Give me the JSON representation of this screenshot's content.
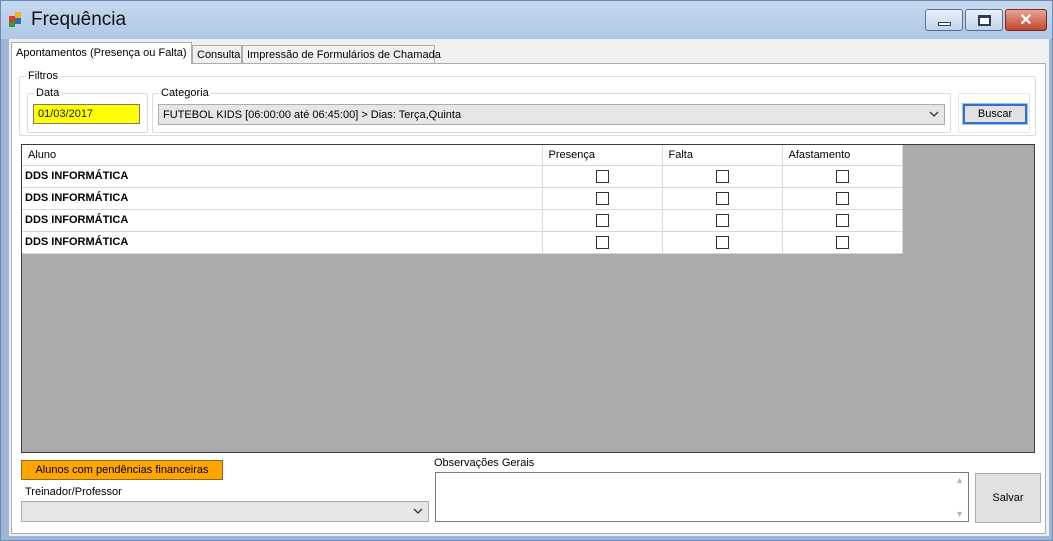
{
  "window": {
    "title": "Frequência"
  },
  "tabs": [
    {
      "label": "Apontamentos (Presença ou Falta)",
      "active": true
    },
    {
      "label": "Consulta",
      "active": false
    },
    {
      "label": "Impressão de Formulários de Chamada",
      "active": false
    }
  ],
  "filtros": {
    "group_label": "Filtros",
    "data_label": "Data",
    "data_value": "01/03/2017",
    "categoria_label": "Categoria",
    "categoria_value": "FUTEBOL KIDS [06:00:00 até 06:45:00] > Dias: Terça,Quinta",
    "buscar_label": "Buscar"
  },
  "grid": {
    "columns": [
      "Aluno",
      "Presença",
      "Falta",
      "Afastamento"
    ],
    "rows": [
      {
        "aluno": "DDS INFORMÁTICA",
        "presenca": false,
        "falta": false,
        "afastamento": false
      },
      {
        "aluno": "DDS INFORMÁTICA",
        "presenca": false,
        "falta": false,
        "afastamento": false
      },
      {
        "aluno": "DDS INFORMÁTICA",
        "presenca": false,
        "falta": false,
        "afastamento": false
      },
      {
        "aluno": "DDS INFORMÁTICA",
        "presenca": false,
        "falta": false,
        "afastamento": false
      }
    ]
  },
  "bottom": {
    "pendencias_label": "Alunos com pendências financeiras",
    "treinador_label": "Treinador/Professor",
    "treinador_value": "",
    "observacoes_label": "Observações Gerais",
    "observacoes_value": "",
    "salvar_label": "Salvar"
  },
  "colors": {
    "data_field_bg": "#ffff00",
    "pendencias_bg": "#ffa500",
    "grid_bg": "#ababab"
  }
}
